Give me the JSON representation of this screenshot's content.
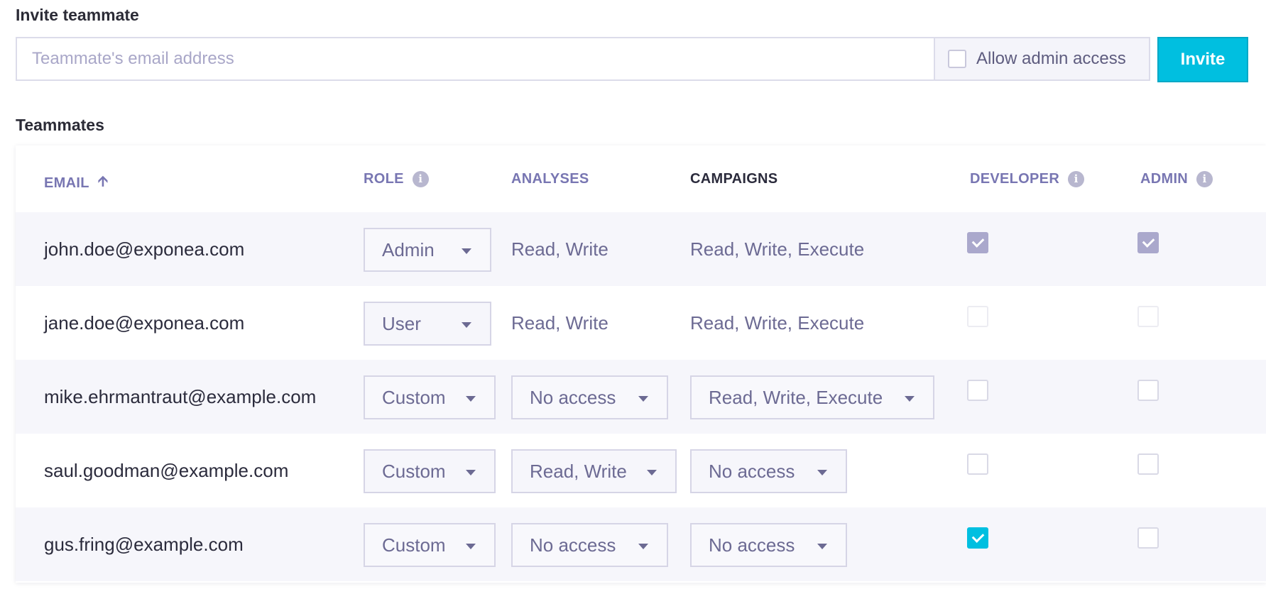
{
  "invite": {
    "title": "Invite teammate",
    "email_placeholder": "Teammate's email address",
    "email_value": "",
    "admin_access_label": "Allow admin access",
    "admin_access_checked": false,
    "invite_button": "Invite"
  },
  "teammates": {
    "title": "Teammates",
    "columns": {
      "email": "EMAIL",
      "role": "ROLE",
      "analyses": "ANALYSES",
      "campaigns": "CAMPAIGNS",
      "developer": "DEVELOPER",
      "admin": "ADMIN"
    },
    "sort_icon": "arrow-up-icon",
    "info_icon": "info-icon",
    "rows": [
      {
        "email": "john.doe@exponea.com",
        "role": "Admin",
        "analyses": "Read, Write",
        "campaigns": "Read, Write, Execute",
        "developer": true,
        "admin": true
      },
      {
        "email": "jane.doe@exponea.com",
        "role": "User",
        "analyses": "Read, Write",
        "campaigns": "Read, Write, Execute",
        "developer": false,
        "admin": false
      },
      {
        "email": "mike.ehrmantraut@example.com",
        "role": "Custom",
        "analyses": "No access",
        "campaigns": "Read, Write, Execute",
        "developer": false,
        "admin": false
      },
      {
        "email": "saul.goodman@example.com",
        "role": "Custom",
        "analyses": "Read, Write",
        "campaigns": "No access",
        "developer": false,
        "admin": false
      },
      {
        "email": "gus.fring@example.com",
        "role": "Custom",
        "analyses": "No access",
        "campaigns": "No access",
        "developer": true,
        "admin": false
      }
    ]
  },
  "colors": {
    "accent": "#00bfe0",
    "header_text": "#7876b2",
    "muted_check": "#aaa8cc"
  }
}
